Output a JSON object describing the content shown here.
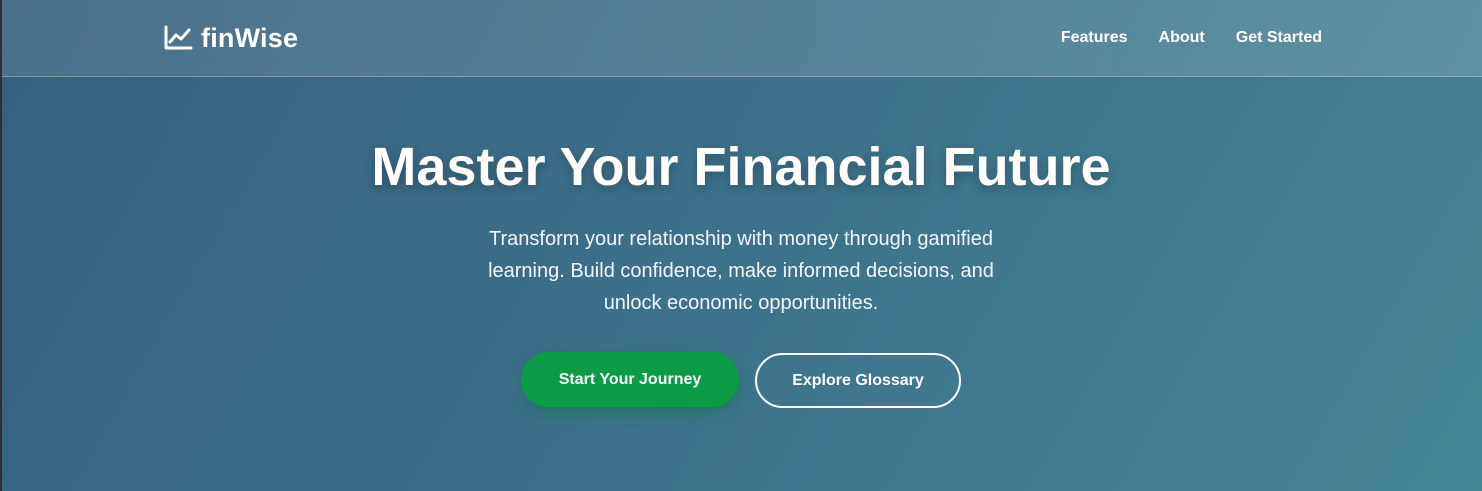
{
  "brand": {
    "name": "finWise",
    "icon": "chart-line-icon"
  },
  "nav": {
    "items": [
      {
        "label": "Features"
      },
      {
        "label": "About"
      },
      {
        "label": "Get Started"
      }
    ]
  },
  "hero": {
    "title": "Master Your Financial Future",
    "subtitle": "Transform your relationship with money through gamified learning. Build confidence, make informed decisions, and unlock economic opportunities.",
    "primary_cta": "Start Your Journey",
    "secondary_cta": "Explore Glossary"
  },
  "colors": {
    "background_start": "#36607f",
    "background_end": "#458596",
    "primary_button": "#0d9c46",
    "text": "#ffffff"
  }
}
